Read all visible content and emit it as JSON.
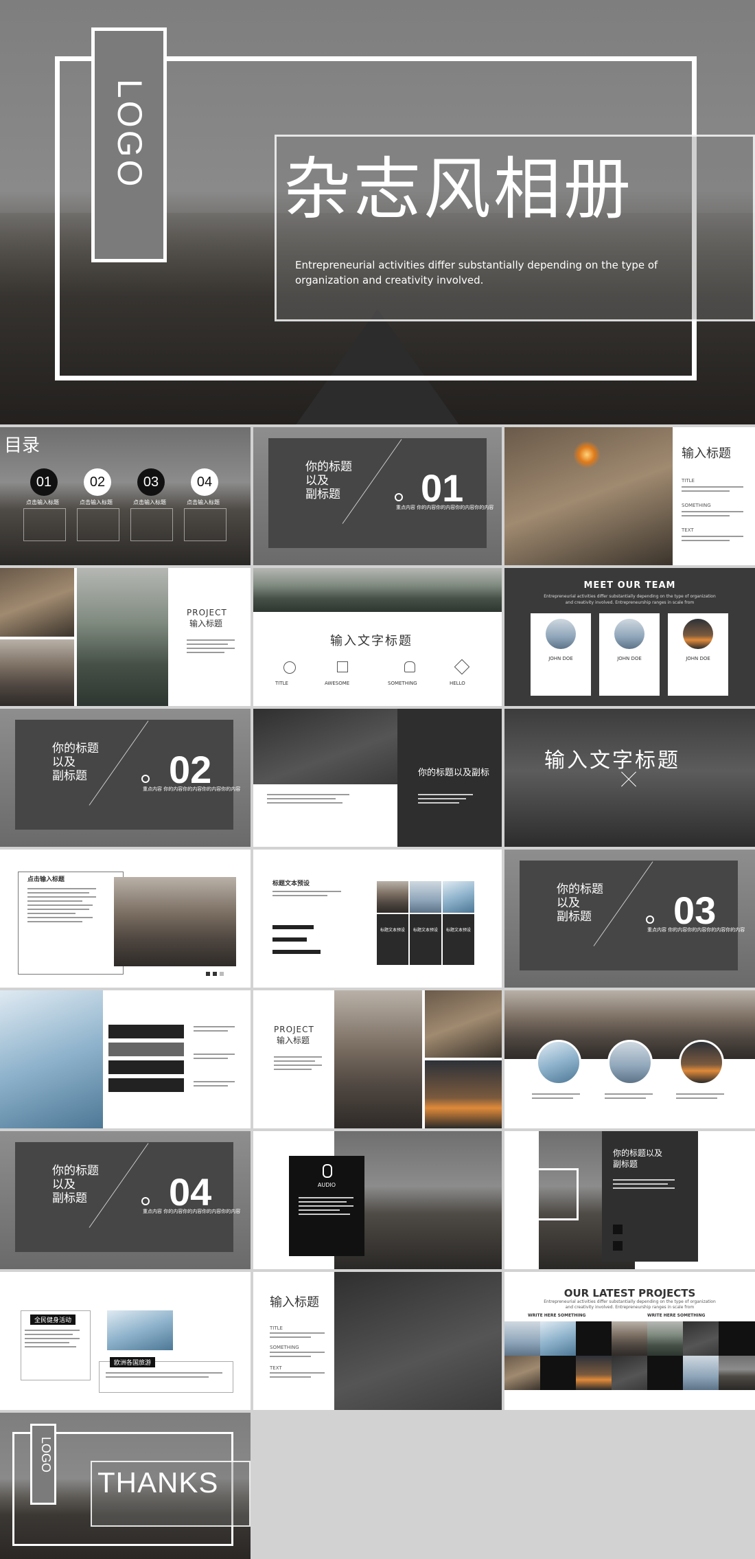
{
  "cover": {
    "logo": "LOGO",
    "title": "杂志风相册",
    "subtitle_line1": "Entrepreneurial activities differ substantially depending on the type of",
    "subtitle_line2": "organization and creativity involved."
  },
  "toc": {
    "title": "目录",
    "items": [
      {
        "num": "01",
        "label": "点击输入标题"
      },
      {
        "num": "02",
        "label": "点击输入标题"
      },
      {
        "num": "03",
        "label": "点击输入标题"
      },
      {
        "num": "04",
        "label": "点击输入标题"
      }
    ]
  },
  "section_title": "你的标题\n以及\n副标题",
  "section_title_lines": [
    "你的标题",
    "以及",
    "副标题"
  ],
  "section_nums": [
    "01",
    "02",
    "03",
    "04"
  ],
  "section_sub_label": "重点内容",
  "section_sub_text": "你的内容你的内容你的内容你的内容",
  "input_title": "输入标题",
  "input_text_title": "输入文字标题",
  "meta_words": {
    "title": "TITLE",
    "something": "SOMETHING",
    "text": "TEXT"
  },
  "project": {
    "en": "PROJECT",
    "cn": "输入标题"
  },
  "icon_row": [
    "TITLE",
    "AWESOME",
    "SOMETHING",
    "HELLO"
  ],
  "team": {
    "title": "MEET OUR TEAM",
    "subtitle_line1": "Entrepreneurial activities differ substantially depending on the type of organization",
    "subtitle_line2": "and creativity involved. Entrepreneurship ranges in scale from",
    "members": [
      {
        "name": "JOHN DOE"
      },
      {
        "name": "JOHN DOE"
      },
      {
        "name": "JOHN DOE"
      }
    ]
  },
  "title_and_subtitle": "你的标题以及副标",
  "click_title": "点击输入标题",
  "label_text_preset": "标题文本预设",
  "preset_tiles": [
    "标题文本预设",
    "标题文本预设",
    "标题文本预设"
  ],
  "titles_with_subtitle": "你的标题以及\n副标题",
  "audio": "AUDIO",
  "fitness": "全民健身活动",
  "europe_tour": "欧洲各国旅游",
  "latest": {
    "title": "OUR LATEST PROJECTS",
    "subtitle_line1": "Entrepreneurial activities differ substantially depending on the type of organization",
    "subtitle_line2": "and creativity involved. Entrepreneurship ranges in scale from",
    "write_here": "WRITE HERE SOMETHING"
  },
  "thanks": {
    "logo": "LOGO",
    "text": "THANKS"
  }
}
